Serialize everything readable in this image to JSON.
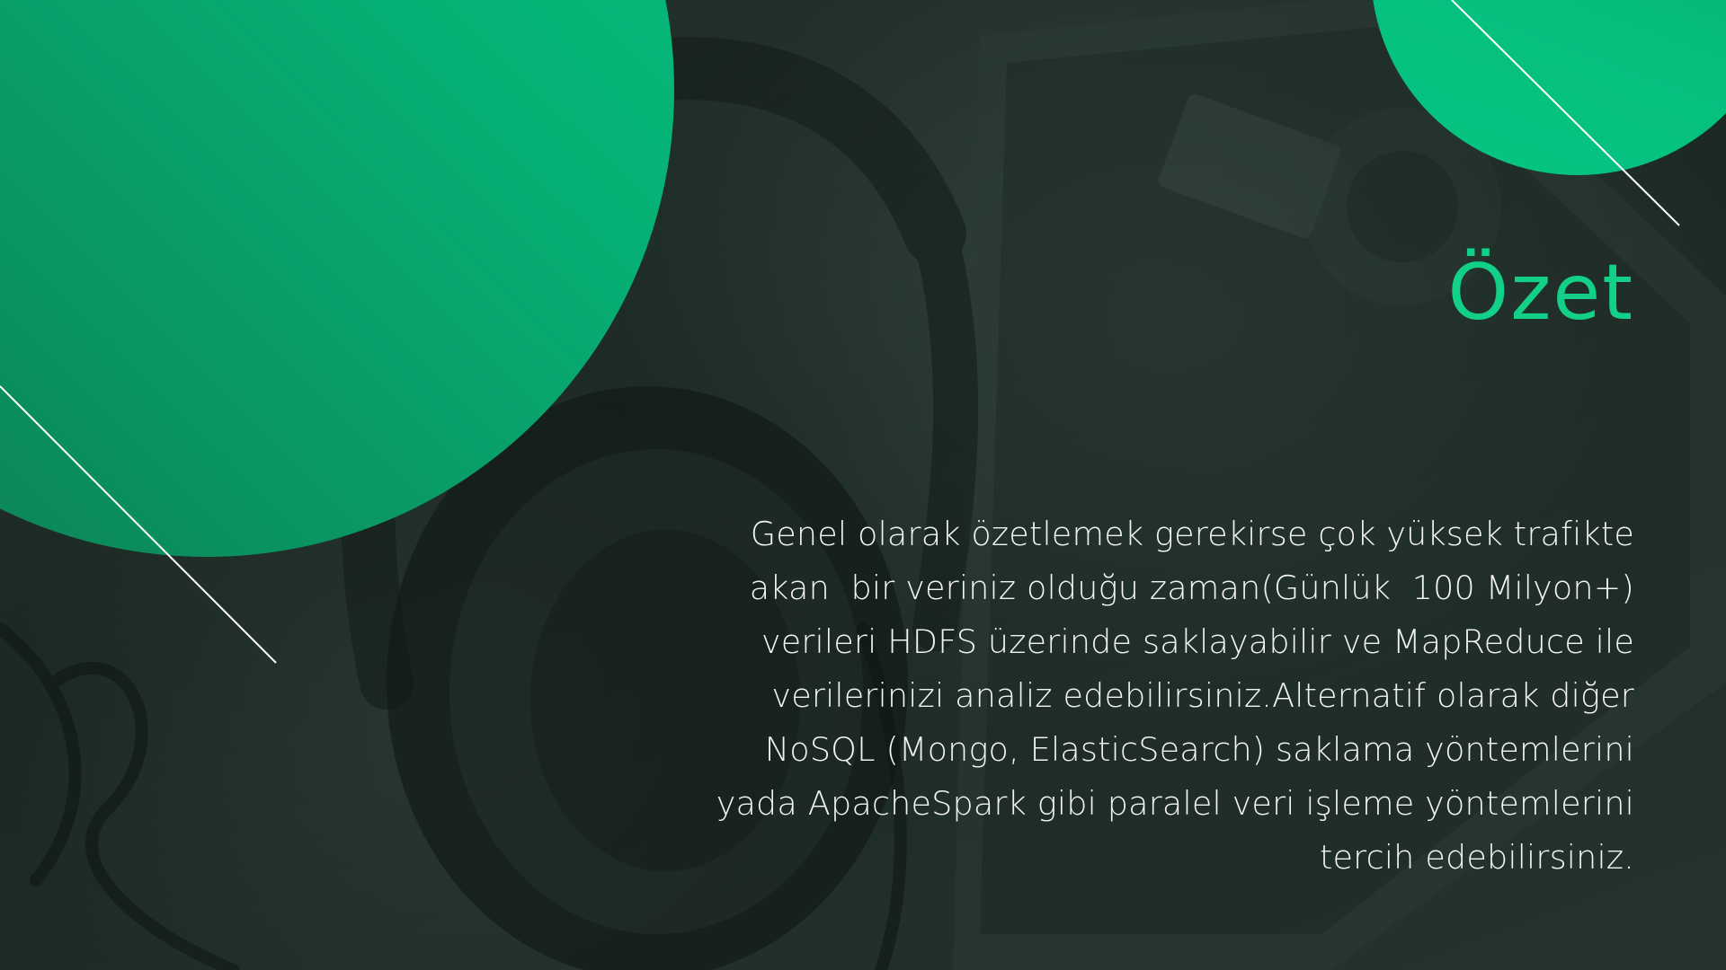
{
  "slide": {
    "title": "Özet",
    "paragraph_lines": [
      "Genel olarak özetlemek gerekirse çok yüksek trafikte",
      "akan  bir veriniz olduğu zaman(Günlük  100 Milyon+)",
      "verileri HDFS üzerinde saklayabilir ve MapReduce ile",
      "verilerinizi analiz edebilirsiniz.Alternatif olarak diğer",
      "NoSQL (Mongo, ElasticSearch) saklama yöntemlerini",
      "yada ApacheSpark gibi paralel veri işleme yöntemlerini",
      "tercih edebilirsiniz."
    ]
  },
  "colors": {
    "accent": "#12d087",
    "circle": "#05c07d",
    "background": "#1c2a25",
    "text": "#f2f4f3"
  }
}
